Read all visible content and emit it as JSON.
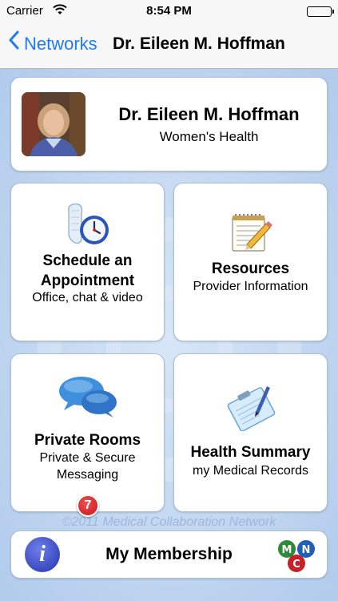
{
  "status_bar": {
    "carrier": "Carrier",
    "time": "8:54 PM"
  },
  "nav": {
    "back_label": "Networks",
    "title": "Dr. Eileen M. Hoffman"
  },
  "profile": {
    "name": "Dr. Eileen M. Hoffman",
    "specialty": "Women's Health"
  },
  "tiles": [
    {
      "title_line1": "Schedule an",
      "title_line2": "Appointment",
      "subtitle": "Office, chat & video",
      "icon": "calendar-clock-icon"
    },
    {
      "title": "Resources",
      "subtitle": "Provider Information",
      "icon": "notepad-pencil-icon"
    },
    {
      "title": "Private Rooms",
      "subtitle_line1": "Private & Secure",
      "subtitle_line2": "Messaging",
      "icon": "chat-bubbles-icon",
      "badge": "7"
    },
    {
      "title": "Health Summary",
      "subtitle": "my Medical Records",
      "icon": "clipboard-pen-icon"
    }
  ],
  "watermark": "©2011 Medical Collaboration Network",
  "membership": {
    "label": "My Membership",
    "info_glyph": "i",
    "logo_letters": [
      "M",
      "C",
      "N"
    ]
  },
  "colors": {
    "accent": "#1f7cf5",
    "badge": "#d2161e",
    "info": "#2e40c0"
  }
}
